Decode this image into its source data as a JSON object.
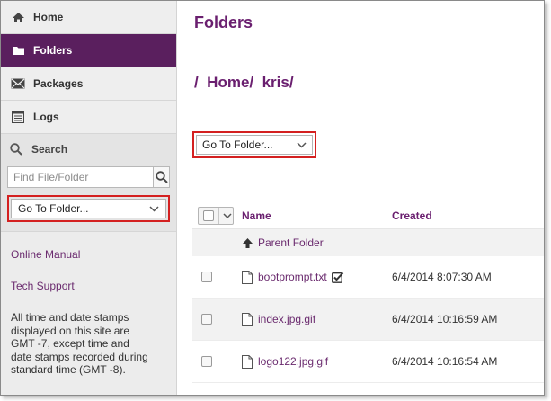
{
  "sidebar": {
    "nav": [
      {
        "label": "Home",
        "icon": "home-icon"
      },
      {
        "label": "Folders",
        "icon": "folder-icon",
        "active": true
      },
      {
        "label": "Packages",
        "icon": "envelope-icon"
      },
      {
        "label": "Logs",
        "icon": "list-icon"
      }
    ],
    "search": {
      "heading": "Search",
      "placeholder": "Find File/Folder",
      "dropdown_value": "Go To Folder..."
    },
    "links": {
      "manual": "Online Manual",
      "support": "Tech Support"
    },
    "note": "All time and date stamps displayed on this site are GMT -7, except time and date stamps recorded during standard time (GMT -8)."
  },
  "main": {
    "title": "Folders",
    "breadcrumb": "/  Home/  kris/",
    "goto_dropdown": "Go To Folder...",
    "table": {
      "col_name": "Name",
      "col_created": "Created",
      "parent": "Parent Folder",
      "rows": [
        {
          "name": "bootprompt.txt",
          "created": "6/4/2014 8:07:30 AM"
        },
        {
          "name": "index.jpg.gif",
          "created": "6/4/2014 10:16:59 AM"
        },
        {
          "name": "logo122.jpg.gif",
          "created": "6/4/2014 10:16:54 AM"
        }
      ]
    }
  },
  "colors": {
    "brand_purple": "#5a1f5e",
    "link_purple": "#6a1f6f",
    "highlight_red": "#d42020"
  }
}
